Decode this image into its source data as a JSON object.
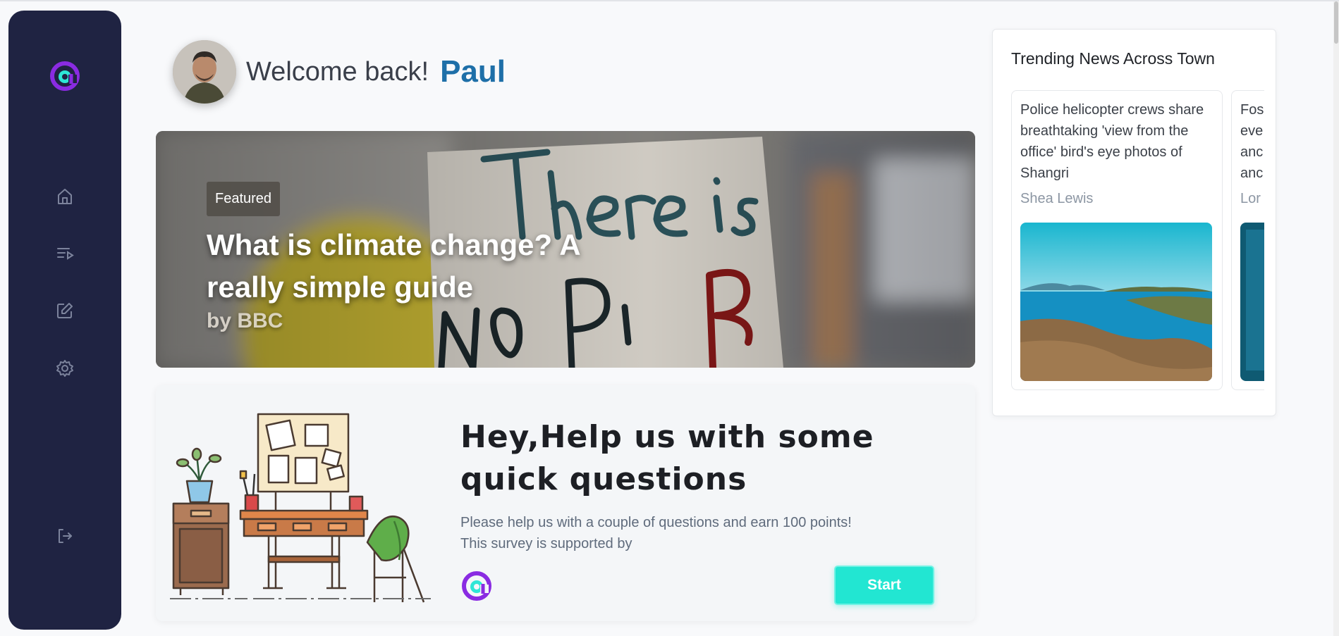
{
  "sidebar": {
    "logo": "app-logo",
    "items": [
      {
        "name": "home",
        "icon": "home-icon"
      },
      {
        "name": "playlist",
        "icon": "playlist-icon"
      },
      {
        "name": "edit",
        "icon": "edit-icon"
      },
      {
        "name": "settings",
        "icon": "gear-icon"
      }
    ],
    "logout_icon": "logout-icon"
  },
  "header": {
    "welcome": "Welcome back!",
    "username": "Paul"
  },
  "featured": {
    "badge": "Featured",
    "title": "What is climate change? A really simple guide",
    "source": "by BBC"
  },
  "survey": {
    "title": "Hey,Help us with some quick questions",
    "description_line1": "Please help us with a couple of questions and earn 100 points!",
    "description_line2": "This survey is supported by",
    "start_label": "Start"
  },
  "trending": {
    "title": "Trending News Across Town",
    "cards": [
      {
        "headline": "Police helicopter crews share breathtaking 'view from the office' bird's eye photos of Shangri",
        "author": "Shea Lewis"
      },
      {
        "headline": "Fos eve anc anc",
        "author": "Lor"
      }
    ]
  },
  "colors": {
    "sidebar_bg": "#1f2342",
    "accent_teal": "#22e6d2",
    "username_blue": "#1e6fa8",
    "logo_purple": "#8a2be2"
  }
}
